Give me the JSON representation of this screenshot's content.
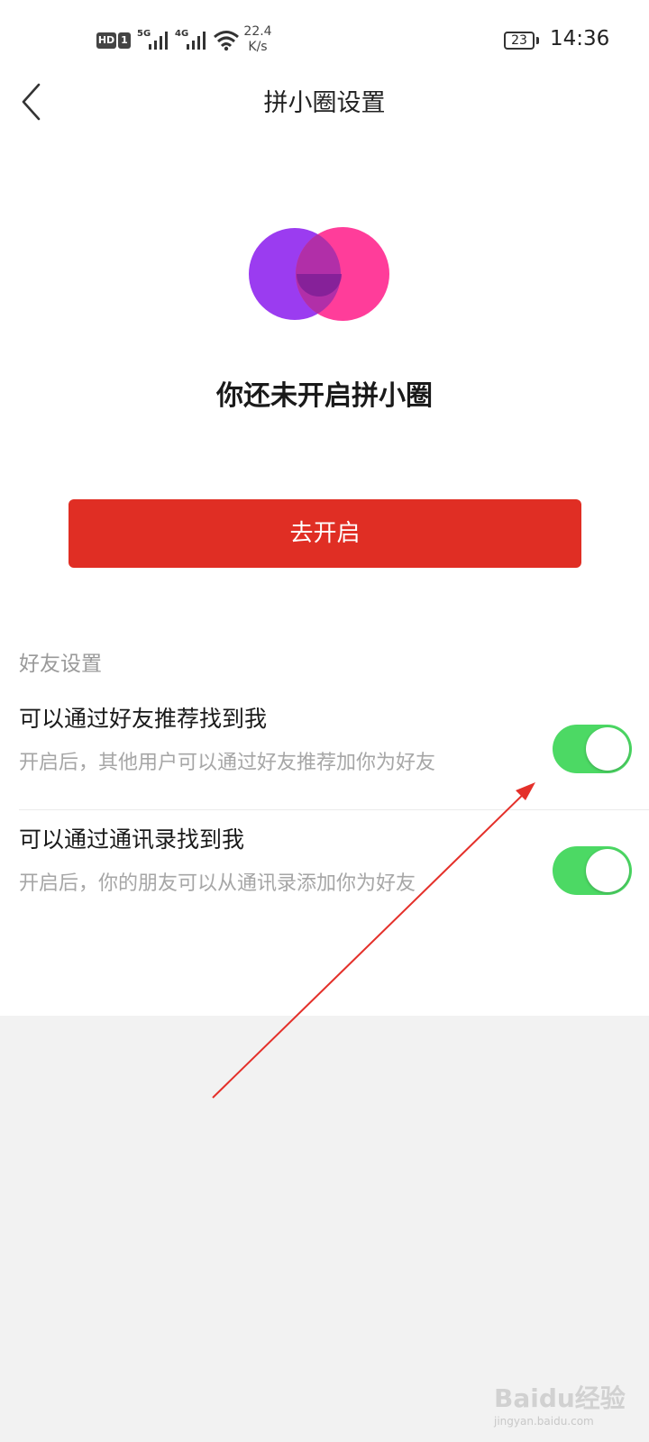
{
  "status_bar": {
    "hd": "HD",
    "sim": "1",
    "net1": "5G",
    "net2": "4G",
    "speed_value": "22.4",
    "speed_unit": "K/s",
    "battery": "23",
    "time": "14:36"
  },
  "nav": {
    "title": "拼小圈设置"
  },
  "hero": {
    "headline": "你还未开启拼小圈",
    "logo_colors": {
      "left": "#9b3cf0",
      "right": "#ff3d9a",
      "overlap": "#a12a9e"
    }
  },
  "enable_button": {
    "label": "去开启",
    "color": "#e02e24"
  },
  "friend_settings": {
    "section_title": "好友设置",
    "items": [
      {
        "title": "可以通过好友推荐找到我",
        "desc": "开启后，其他用户可以通过好友推荐加你为好友",
        "enabled": true
      },
      {
        "title": "可以通过通讯录找到我",
        "desc": "开启后，你的朋友可以从通讯录添加你为好友",
        "enabled": true
      }
    ],
    "toggle_on_color": "#4cd964"
  },
  "watermark": {
    "main": "Baidu经验",
    "sub": "jingyan.baidu.com"
  },
  "icons": {
    "back": "chevron-left-icon",
    "wifi": "wifi-icon",
    "signal": "signal-bars-icon",
    "battery": "battery-icon"
  }
}
